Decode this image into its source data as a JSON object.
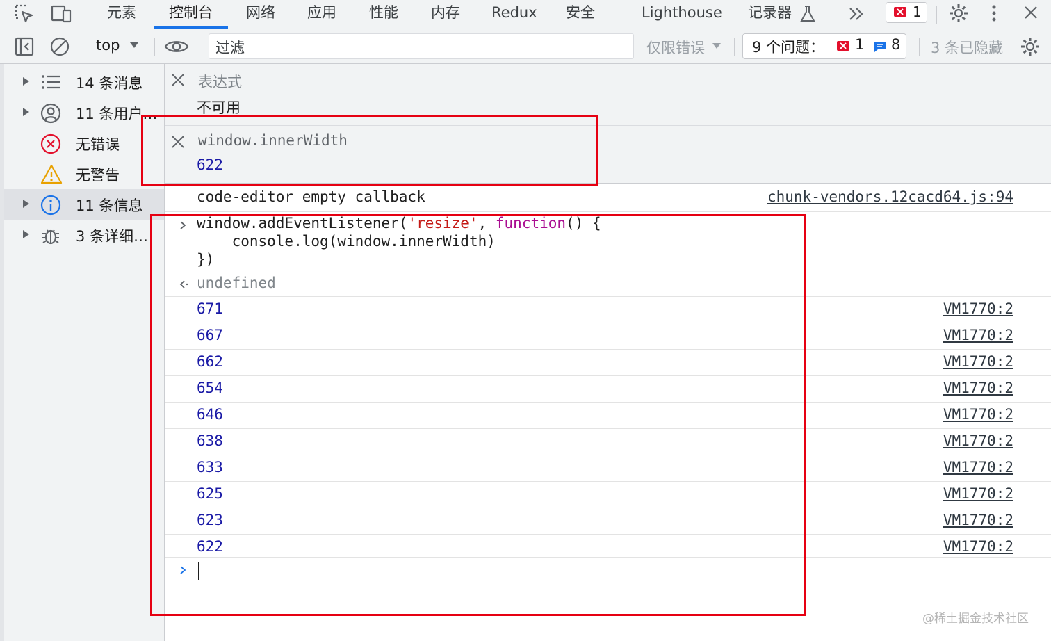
{
  "tabs": [
    {
      "label": "元素"
    },
    {
      "label": "控制台"
    },
    {
      "label": "网络"
    },
    {
      "label": "应用"
    },
    {
      "label": "性能"
    },
    {
      "label": "内存"
    },
    {
      "label": "Redux"
    },
    {
      "label": "安全"
    },
    {
      "label": "Lighthouse"
    },
    {
      "label": "记录器"
    }
  ],
  "active_tab": "控制台",
  "error_badge_count": "1",
  "toolbar": {
    "context": "top",
    "filter_placeholder": "过滤",
    "level": "仅限错误",
    "issues_label": "9 个问题：",
    "issues_errors": "1",
    "issues_info": "8",
    "hidden": "3 条已隐藏"
  },
  "sidebar": {
    "items": [
      {
        "label": "14 条消息",
        "icon": "list-icon",
        "expandable": true
      },
      {
        "label": "11 条用户…",
        "icon": "user-icon",
        "expandable": true
      },
      {
        "label": "无错误",
        "icon": "error-icon",
        "expandable": false
      },
      {
        "label": "无警告",
        "icon": "warning-icon",
        "expandable": false
      },
      {
        "label": "11 条信息",
        "icon": "info-icon",
        "expandable": true,
        "selected": true
      },
      {
        "label": "3 条详细…",
        "icon": "bug-icon",
        "expandable": true
      }
    ]
  },
  "live_expressions": [
    {
      "expression": "表达式",
      "value": "不可用"
    },
    {
      "expression": "window.innerWidth",
      "value": "622"
    }
  ],
  "console": {
    "log_message": "code-editor empty callback",
    "log_source": "chunk-vendors.12cacd64.js:94",
    "input_code": {
      "line1_a": "window.addEventListener(",
      "line1_str": "'resize'",
      "line1_b": ", ",
      "line1_kw": "function",
      "line1_c": "() {",
      "line2": "console.log(window.innerWidth)",
      "line3": "})"
    },
    "result": "undefined",
    "outputs": [
      {
        "value": "671",
        "source": "VM1770:2"
      },
      {
        "value": "667",
        "source": "VM1770:2"
      },
      {
        "value": "662",
        "source": "VM1770:2"
      },
      {
        "value": "654",
        "source": "VM1770:2"
      },
      {
        "value": "646",
        "source": "VM1770:2"
      },
      {
        "value": "638",
        "source": "VM1770:2"
      },
      {
        "value": "633",
        "source": "VM1770:2"
      },
      {
        "value": "625",
        "source": "VM1770:2"
      },
      {
        "value": "623",
        "source": "VM1770:2"
      },
      {
        "value": "622",
        "source": "VM1770:2"
      }
    ]
  },
  "watermark": "@稀土掘金技术社区",
  "colors": {
    "accent": "#1a73e8",
    "highlight_box": "#e60012",
    "number": "#1a1aa6",
    "string": "#c41a16",
    "keyword": "#aa0d91"
  }
}
